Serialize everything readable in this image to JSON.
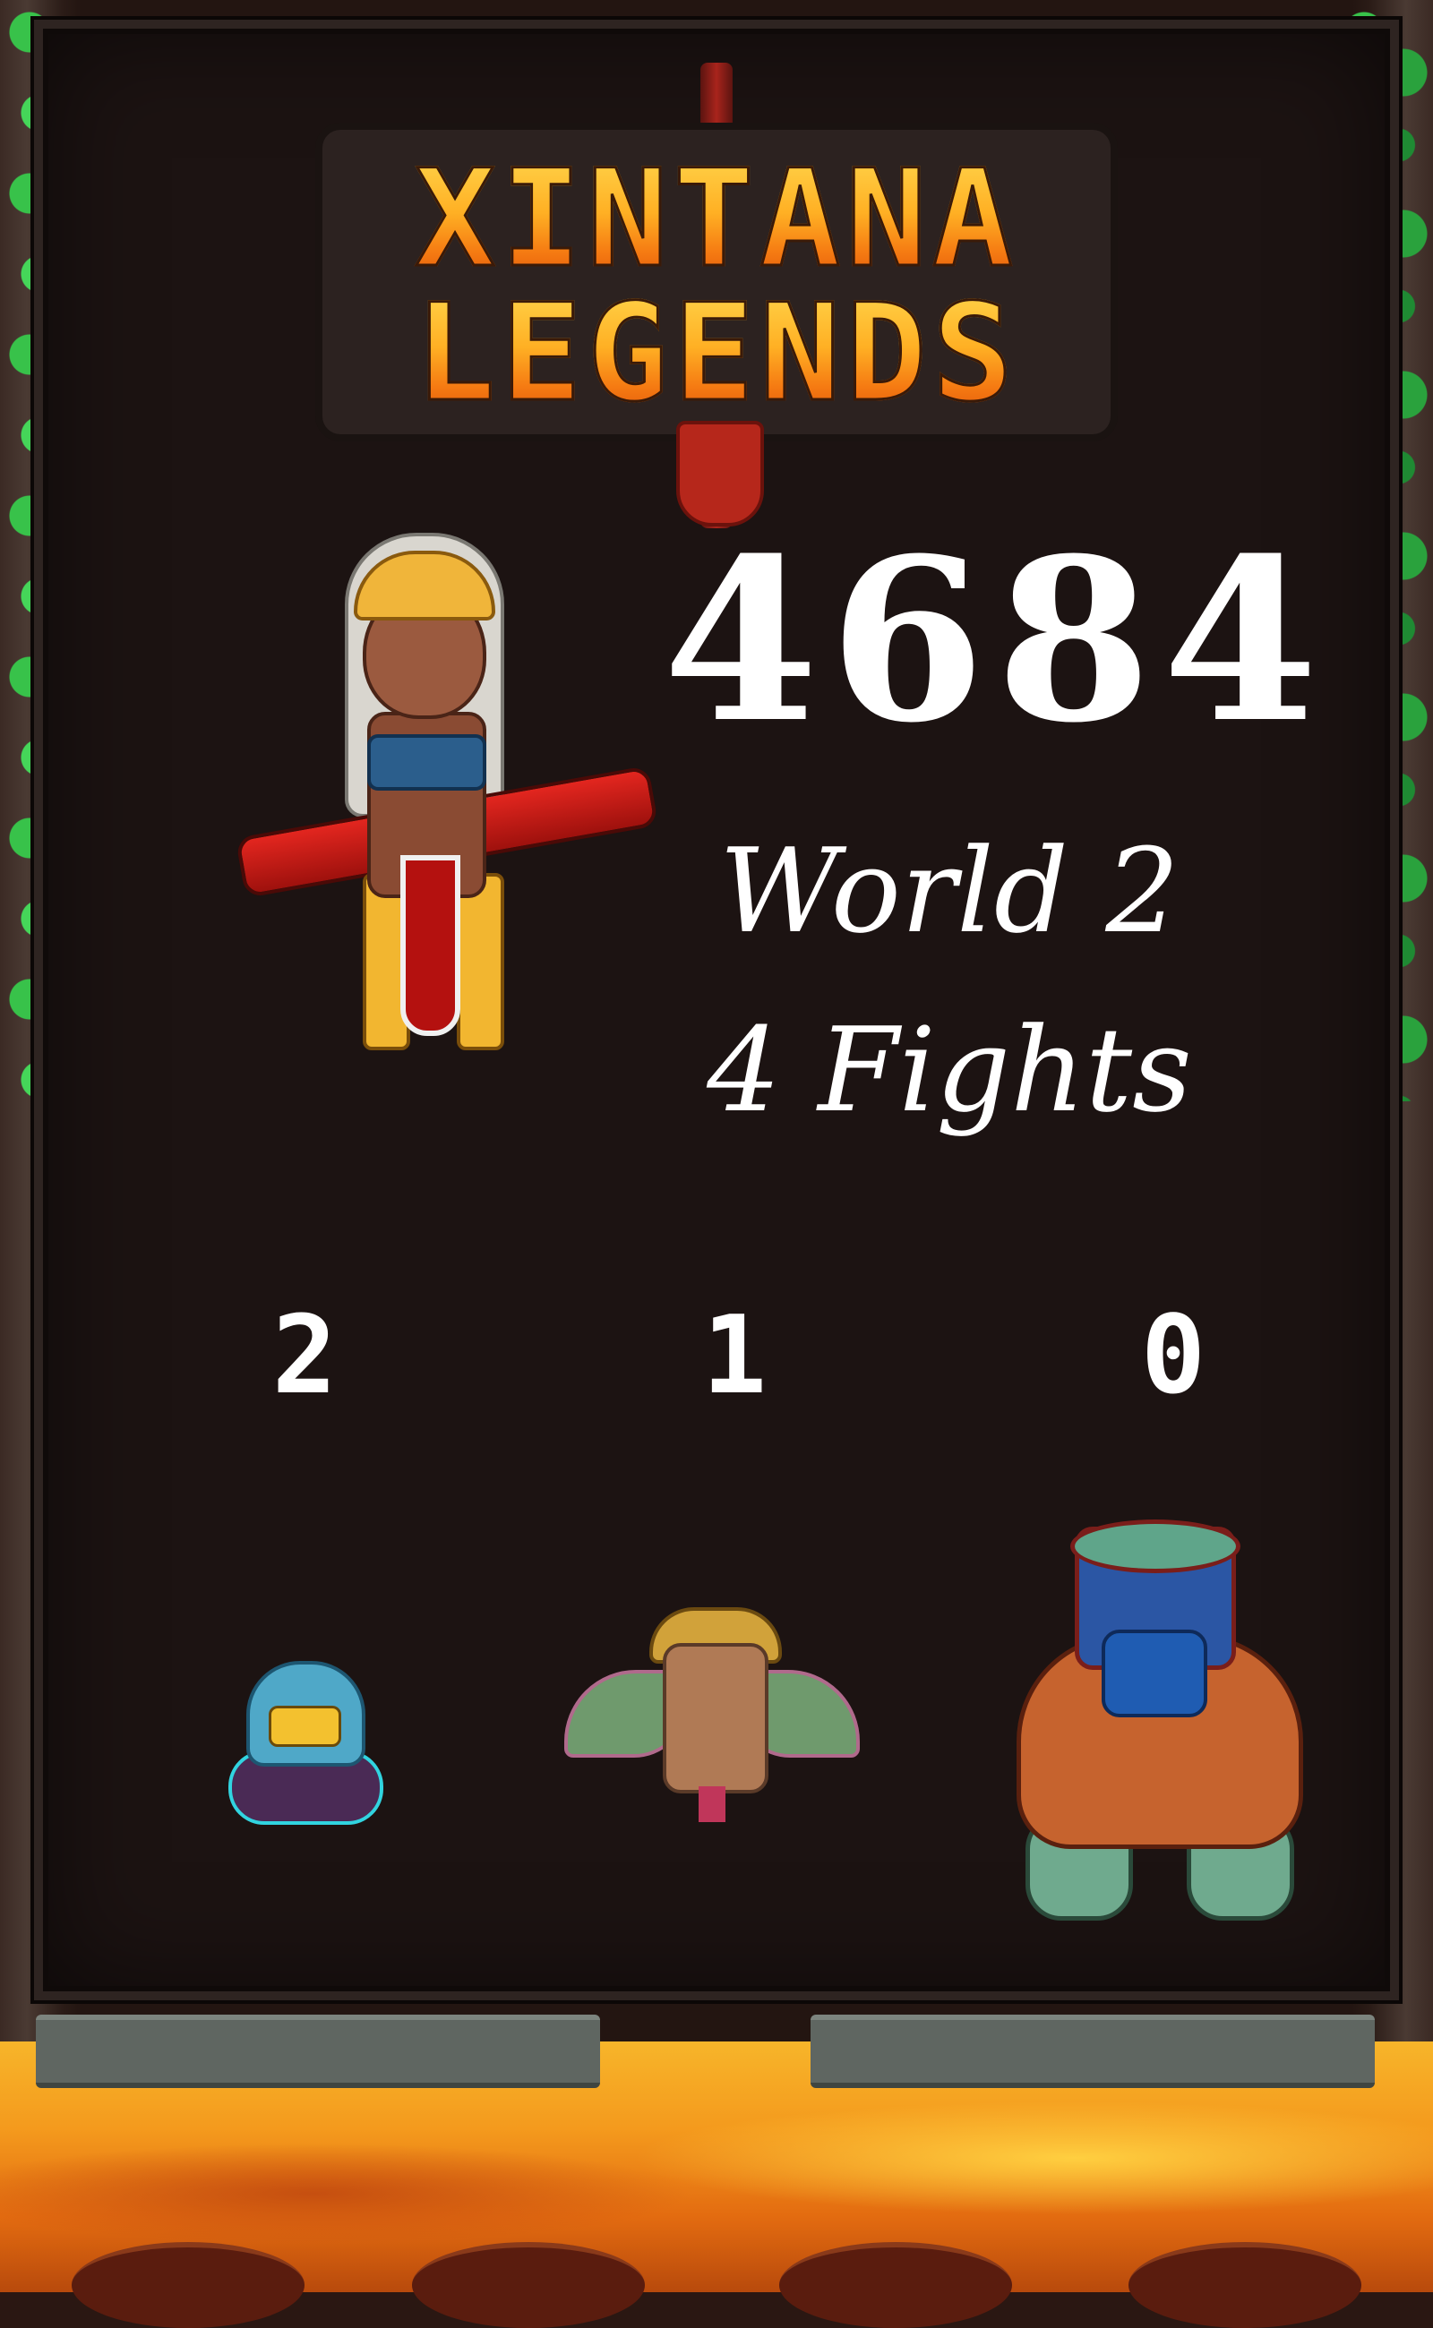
{
  "logo": {
    "line1": "XINTANA",
    "line2": "LEGENDS"
  },
  "score": "4684",
  "world": "World 2",
  "fights": "4 Fights",
  "enemy_counts": [
    "2",
    "1",
    "0"
  ],
  "enemies": [
    "hooded-skull-minion",
    "winged-mask-spirit",
    "stone-golem-drum"
  ],
  "hero": "heroine-with-club",
  "colors": {
    "board": "#1c1312",
    "text": "#ffffff",
    "logo_top": "#ffd44a",
    "logo_bottom": "#e0560a",
    "lava": "#f49a1d",
    "vine": "#38c24a"
  }
}
